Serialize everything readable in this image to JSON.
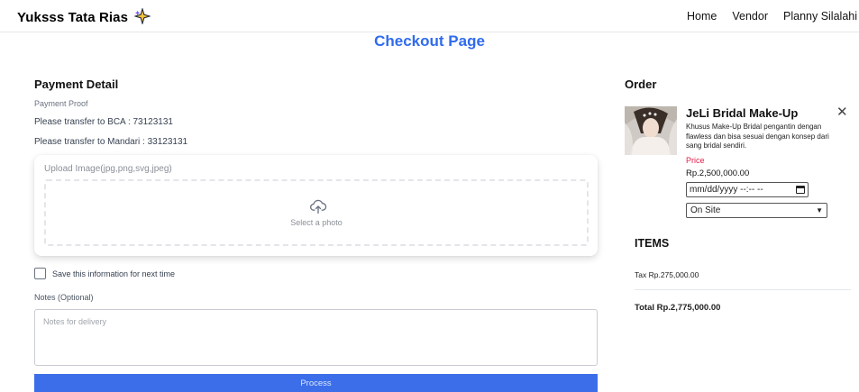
{
  "nav": {
    "brand": "Yuksss Tata Rias",
    "brand_icon": "sparkle-icon",
    "links": [
      "Home",
      "Vendor",
      "Planny Silalahi"
    ]
  },
  "page": {
    "title": "Checkout Page"
  },
  "payment": {
    "title": "Payment Detail",
    "proof_label": "Payment Proof",
    "transfer_bca": "Please transfer to BCA : 73123131",
    "transfer_mandari": "Please transfer to Mandari : 33123131",
    "upload_label": "Upload Image(jpg,png,svg,jpeg)",
    "upload_icon": "cloud-upload-icon",
    "upload_text": "Select a photo",
    "save_label": "Save this information for next time",
    "notes_label": "Notes (Optional)",
    "notes_placeholder": "Notes for delivery",
    "process_label": "Process"
  },
  "order": {
    "title": "Order",
    "product_name": "JeLi Bridal Make-Up",
    "product_desc": "Khusus Make-Up Bridal pengantin dengan flawless dan bisa sesuai dengan konsep dari sang bridal sendiri.",
    "price_label": "Price",
    "price_value": "Rp.2,500,000.00",
    "date_value": "mm/dd/yyyy --:-- --",
    "location_value": "On Site",
    "close_icon": "close-icon",
    "items_title": "ITEMS",
    "tax": "Tax  Rp.275,000.00",
    "total": "Total  Rp.2,775,000.00"
  },
  "colors": {
    "accent": "#2f6bed",
    "button": "#3b6ee8",
    "price": "#e11d48"
  }
}
